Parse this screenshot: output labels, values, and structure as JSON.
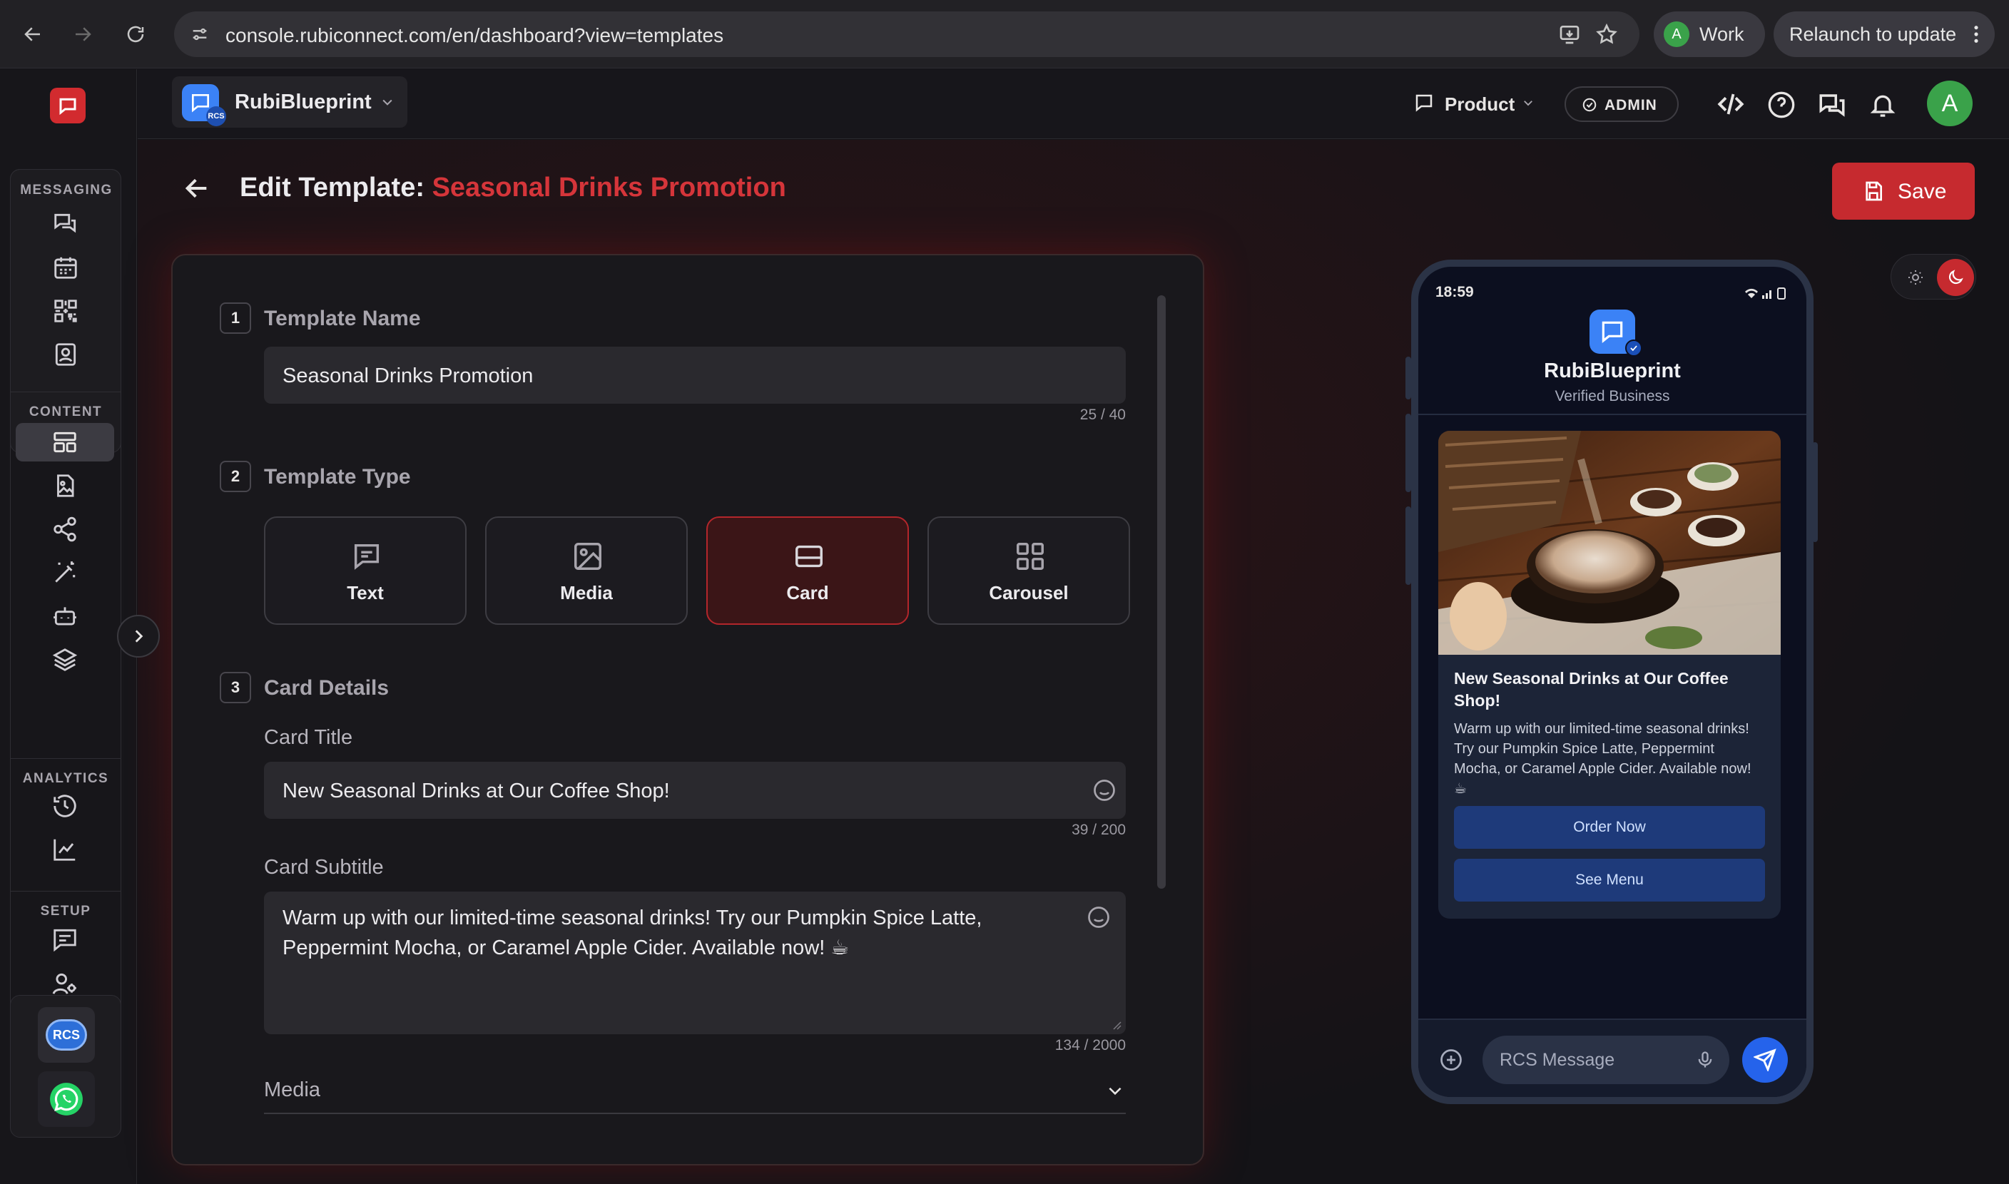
{
  "browser": {
    "url": "console.rubiconnect.com/en/dashboard?view=templates",
    "profile_initial": "A",
    "profile_label": "Work",
    "relaunch_label": "Relaunch to update"
  },
  "rail": {
    "sections": [
      "MESSAGING",
      "CONTENT",
      "ANALYTICS",
      "SETUP"
    ],
    "channels": [
      "RCS",
      "WhatsApp"
    ]
  },
  "header": {
    "workspace": "RubiBlueprint",
    "workspace_badge": "RCS",
    "product_label": "Product",
    "role_badge": "ADMIN",
    "avatar_initial": "A"
  },
  "page": {
    "title_prefix": "Edit Template:",
    "title_name": "Seasonal Drinks Promotion",
    "save_label": "Save"
  },
  "form": {
    "step1": {
      "num": "1",
      "title": "Template Name",
      "value": "Seasonal Drinks Promotion",
      "counter": "25 / 40"
    },
    "step2": {
      "num": "2",
      "title": "Template Type",
      "types": [
        {
          "label": "Text",
          "icon": "message-square-icon"
        },
        {
          "label": "Media",
          "icon": "image-icon"
        },
        {
          "label": "Card",
          "icon": "card-icon"
        },
        {
          "label": "Carousel",
          "icon": "grid-icon"
        }
      ],
      "selected": "Card"
    },
    "step3": {
      "num": "3",
      "title": "Card Details",
      "card_title_label": "Card Title",
      "card_title_value": "New Seasonal Drinks at Our Coffee Shop!",
      "card_title_counter": "39 / 200",
      "card_subtitle_label": "Card Subtitle",
      "card_subtitle_value": "Warm up with our limited-time seasonal drinks! Try our Pumpkin Spice Latte, Peppermint Mocha, or Caramel Apple Cider. Available now! ☕",
      "card_subtitle_counter": "134 / 2000",
      "media_label": "Media"
    }
  },
  "preview": {
    "time": "18:59",
    "business_name": "RubiBlueprint",
    "verified_label": "Verified Business",
    "card_title": "New Seasonal Drinks at Our Coffee Shop!",
    "card_body": "Warm up with our limited-time seasonal drinks! Try our Pumpkin Spice Latte, Peppermint Mocha, or Caramel Apple Cider. Available now! ☕",
    "buttons": [
      "Order Now",
      "See Menu"
    ],
    "composer_placeholder": "RCS Message"
  },
  "colors": {
    "accent": "#c62a2f",
    "brand_blue": "#3b82f6",
    "whatsapp": "#25d366"
  }
}
